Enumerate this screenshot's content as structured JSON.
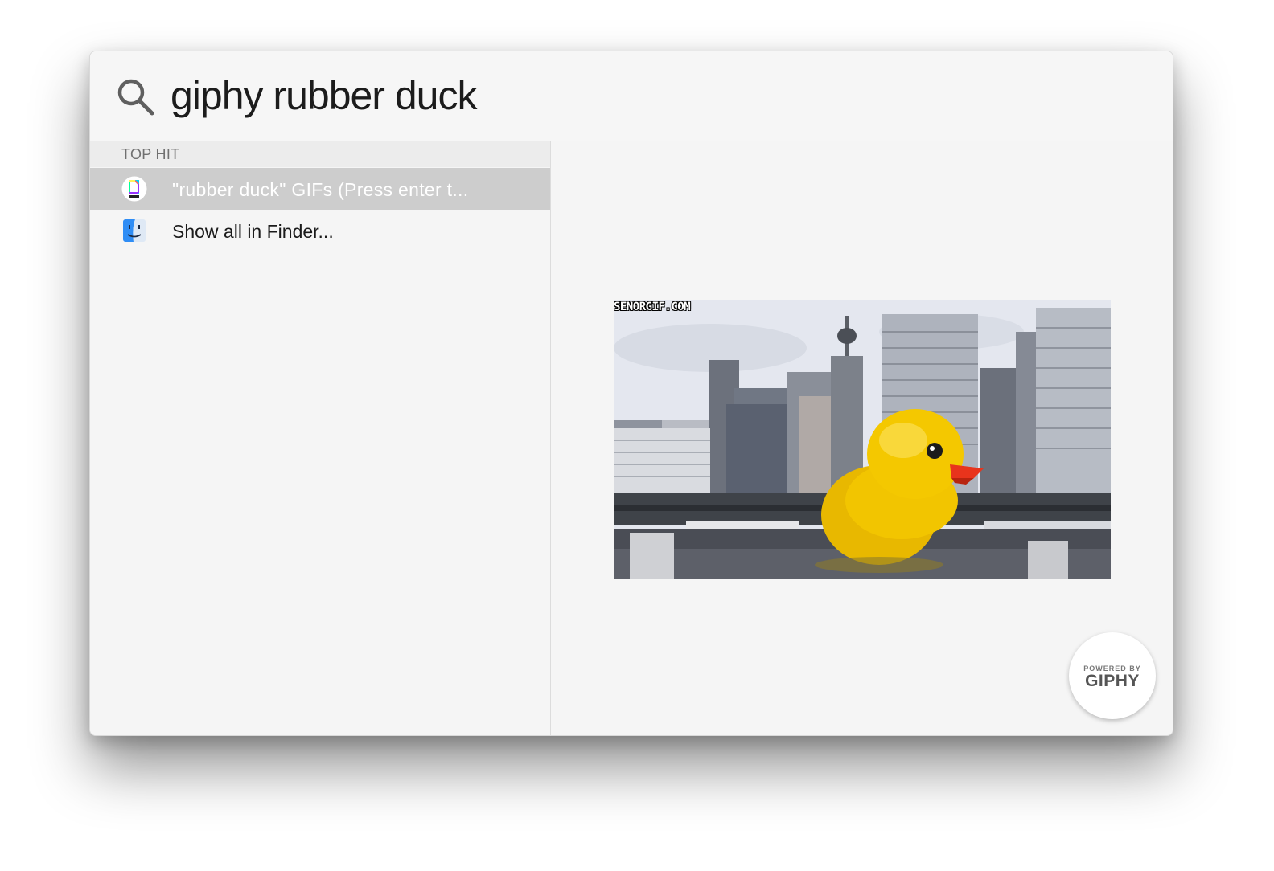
{
  "search": {
    "query": "giphy rubber duck"
  },
  "results": {
    "section_header": "TOP HIT",
    "items": [
      {
        "label": "\"rubber duck\" GIFs (Press enter t...",
        "icon": "giphy-app-icon",
        "selected": true
      },
      {
        "label": "Show all in Finder...",
        "icon": "finder-icon",
        "selected": false
      }
    ]
  },
  "preview": {
    "watermark": "SENORGIF.COM",
    "badge_top": "POWERED BY",
    "badge_brand": "GIPHY"
  },
  "colors": {
    "selection": "#cdcdcd",
    "window_bg": "#f5f5f5",
    "duck_yellow": "#f2c500",
    "duck_beak": "#e8341c"
  }
}
